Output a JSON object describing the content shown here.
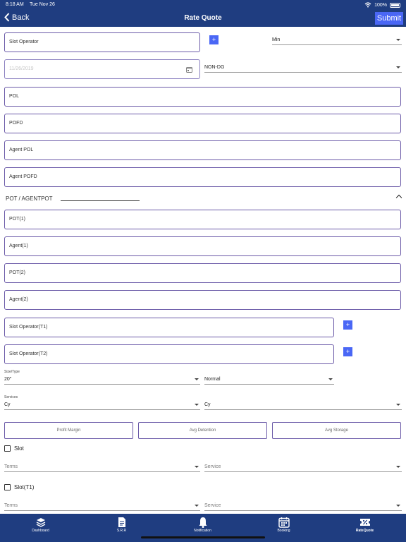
{
  "status_bar": {
    "time": "8:18 AM",
    "date": "Tue Nov 26",
    "battery": "100%"
  },
  "nav": {
    "back_label": "Back",
    "title": "Rate Quote",
    "submit_label": "Submit"
  },
  "form": {
    "slot_operator": "Slot Operator",
    "unit": {
      "value": "Min"
    },
    "date": {
      "placeholder": "11/26/2019"
    },
    "cargo_type": {
      "value": "NON-DG"
    },
    "pol": "POL",
    "pofd": "POFD",
    "agent_pol": "Agent POL",
    "agent_pofd": "Agent POFD",
    "pot_section": "POT / AGENTPOT",
    "pot1": "POT(1)",
    "agent1": "Agent(1)",
    "pot2": "POT(2)",
    "agent2": "Agent(2)",
    "slot_operator_t1": "Slot Operator(T1)",
    "slot_operator_t2": "Slot Operator(T2)",
    "plus_symbol": "+",
    "size_type": {
      "label": "Size/Type",
      "value": "20\"",
      "mode": "Normal"
    },
    "services": {
      "label": "Services",
      "value1": "Cy",
      "value2": "Cy"
    },
    "buttons": {
      "profit_margin": "Profit Margin",
      "avg_detention": "Avg Detention",
      "avg_storage": "Avg Storage"
    },
    "slot": {
      "label": "Slot",
      "terms": "Terms",
      "service": "Service"
    },
    "slot_t1": {
      "label": "Slot(T1)",
      "terms": "Terms",
      "service": "Service"
    }
  },
  "tabs": [
    {
      "label": "Dashboard",
      "icon": "layers-icon"
    },
    {
      "label": "S.R.R",
      "icon": "document-icon"
    },
    {
      "label": "Notification",
      "icon": "bell-icon"
    },
    {
      "label": "Booking",
      "icon": "calendar-icon"
    },
    {
      "label": "RateQuote",
      "icon": "percent-ticket-icon",
      "active": true
    }
  ],
  "colors": {
    "primary": "#1f3d80",
    "accent": "#4a67f5",
    "border": "#6b5aa8"
  }
}
